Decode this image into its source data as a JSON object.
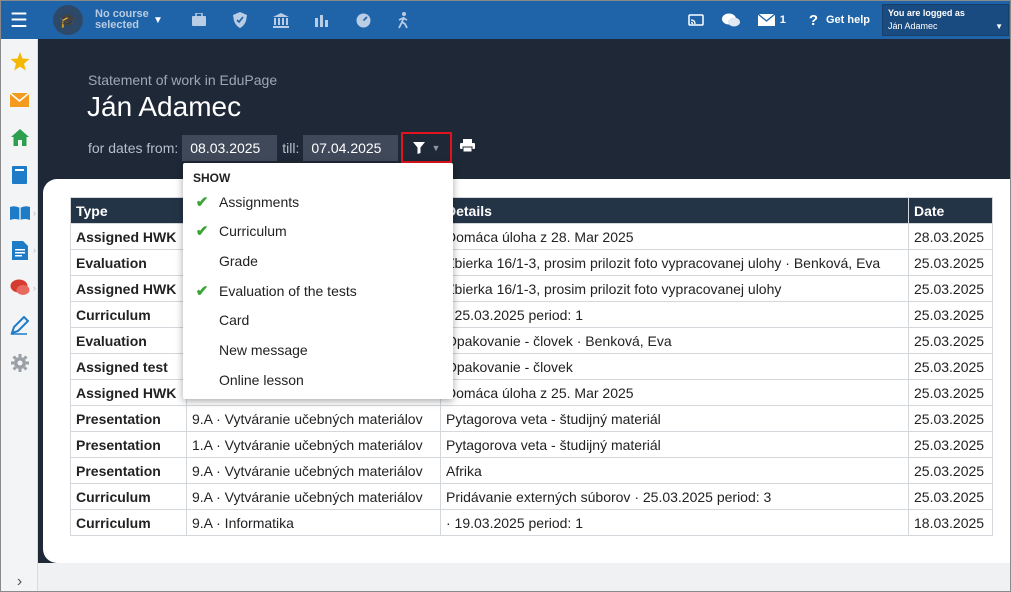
{
  "topbar": {
    "course_label": "No course selected",
    "icons": [
      "briefcase-icon",
      "shield-icon",
      "bank-icon",
      "bar-chart-icon",
      "gauge-icon",
      "walking-icon"
    ],
    "messages_count": "1",
    "help_label": "Get help",
    "logged_label": "You are logged as",
    "logged_user": "Ján Adamec"
  },
  "sidebar": {
    "items": [
      {
        "icon": "star-icon",
        "color": "#f5b800"
      },
      {
        "icon": "envelope-icon",
        "color": "#f29b1f"
      },
      {
        "icon": "home-icon",
        "color": "#2e9e4f"
      },
      {
        "icon": "book-icon",
        "color": "#1e7bc7"
      },
      {
        "icon": "open-book-icon",
        "color": "#1e7bc7"
      },
      {
        "icon": "document-icon",
        "color": "#1e7bc7"
      },
      {
        "icon": "chat-icon",
        "color": "#d63b2f"
      },
      {
        "icon": "pen-icon",
        "color": "#1e7bc7"
      },
      {
        "icon": "gear-icon",
        "color": "#9aa0a6"
      }
    ]
  },
  "header": {
    "subtitle": "Statement of work in EduPage",
    "title": "Ján Adamec",
    "dates_label": "for dates from:",
    "date_from": "08.03.2025",
    "till_label": "till:",
    "date_till": "07.04.2025"
  },
  "dropdown": {
    "heading": "SHOW",
    "items": [
      {
        "label": "Assignments",
        "checked": true
      },
      {
        "label": "Curriculum",
        "checked": true
      },
      {
        "label": "Grade",
        "checked": false
      },
      {
        "label": "Evaluation of the tests",
        "checked": true
      },
      {
        "label": "Card",
        "checked": false
      },
      {
        "label": "New message",
        "checked": false
      },
      {
        "label": "Online lesson",
        "checked": false
      }
    ]
  },
  "table": {
    "headers": [
      "Type",
      "",
      "Details",
      "Date"
    ],
    "rows": [
      {
        "type": "Assigned HWK",
        "subject": "",
        "details": "Domáca úloha z 28. Mar 2025",
        "date": "28.03.2025"
      },
      {
        "type": "Evaluation",
        "subject": "",
        "details": "Zbierka 16/1-3, prosim prilozit foto vypracovanej ulohy · Benková, Eva",
        "date": "25.03.2025"
      },
      {
        "type": "Assigned HWK",
        "subject": "",
        "details": "Zbierka 16/1-3, prosim prilozit foto vypracovanej ulohy",
        "date": "25.03.2025"
      },
      {
        "type": "Curriculum",
        "subject": "",
        "details": "· 25.03.2025 period: 1",
        "date": "25.03.2025"
      },
      {
        "type": "Evaluation",
        "subject": "",
        "details": "Opakovanie - človek · Benková, Eva",
        "date": "25.03.2025"
      },
      {
        "type": "Assigned test",
        "subject": "",
        "details": "Opakovanie - človek",
        "date": "25.03.2025"
      },
      {
        "type": "Assigned HWK",
        "subject": "",
        "details": "Domáca úloha z 25. Mar 2025",
        "date": "25.03.2025"
      },
      {
        "type": "Presentation",
        "subject": "9.A · Vytváranie učebných materiálov",
        "details": "Pytagorova veta - študijný materiál",
        "date": "25.03.2025"
      },
      {
        "type": "Presentation",
        "subject": "1.A · Vytváranie učebných materiálov",
        "details": "Pytagorova veta - študijný materiál",
        "date": "25.03.2025"
      },
      {
        "type": "Presentation",
        "subject": "9.A · Vytváranie učebných materiálov",
        "details": "Afrika",
        "date": "25.03.2025"
      },
      {
        "type": "Curriculum",
        "subject": "9.A · Vytváranie učebných materiálov",
        "details": "Pridávanie externých súborov · 25.03.2025 period: 3",
        "date": "25.03.2025"
      },
      {
        "type": "Curriculum",
        "subject": "9.A · Informatika",
        "details": "· 19.03.2025 period: 1",
        "date": "18.03.2025"
      }
    ]
  }
}
